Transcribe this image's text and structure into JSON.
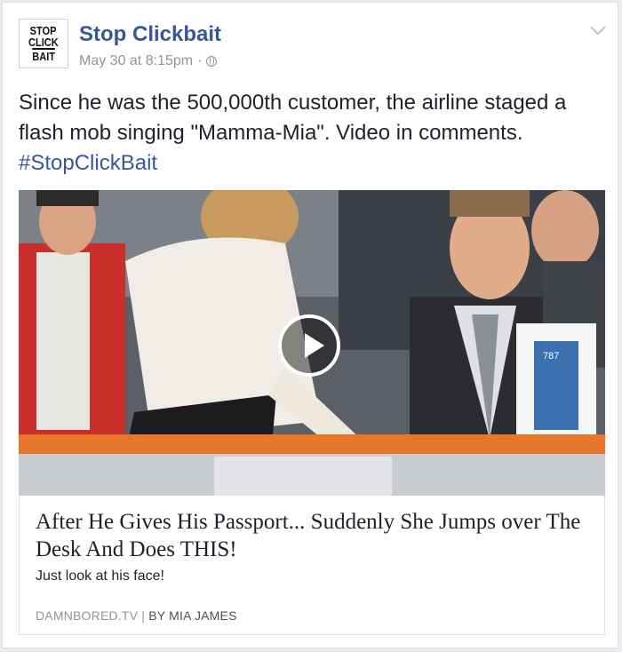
{
  "post": {
    "avatar_lines": [
      "STOP",
      "CLICK",
      "BAIT"
    ],
    "page_name": "Stop Clickbait",
    "timestamp": "May 30 at 8:15pm",
    "separator": "·",
    "privacy_icon": "globe-icon",
    "text": "Since he was the 500,000th customer, the airline staged a flash mob singing \"Mamma-Mia\". Video in comments.",
    "hashtag": "#StopClickBait"
  },
  "link": {
    "title": "After He Gives His Passport... Suddenly She Jumps over The Desk And Does THIS!",
    "description": "Just look at his face!",
    "source": "DAMNBORED.TV",
    "divider": "|",
    "byline": "BY MIA JAMES"
  },
  "media": {
    "play_icon": "play-icon",
    "badge": "787"
  },
  "colors": {
    "link_blue": "#365899",
    "meta_gray": "#90949c",
    "text": "#1d2129",
    "desk_orange": "#e8762b"
  }
}
